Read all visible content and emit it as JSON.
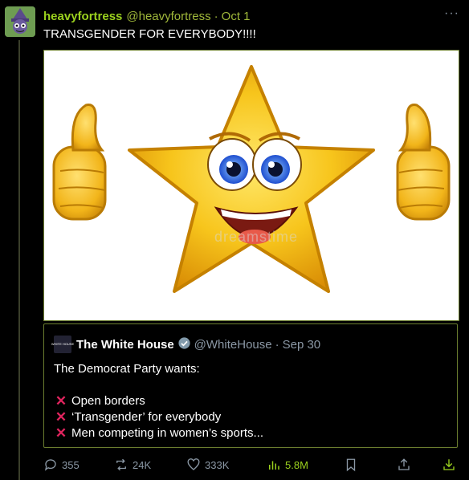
{
  "tweet": {
    "author_name": "heavyfortress",
    "author_handle": "@heavyfortress",
    "separator": "·",
    "date": "Oct 1",
    "more": "···",
    "text": "TRANSGENDER FOR EVERYBODY!!!!",
    "media_watermark": "dreamstime"
  },
  "quote": {
    "author_name": "The White House",
    "author_handle": "@WhiteHouse",
    "separator": "·",
    "date": "Sep 30",
    "avatar_text": "WHITE HOUSE",
    "intro": "The Democrat Party wants:",
    "items": [
      "Open borders",
      "‘Transgender’ for everybody",
      "Men competing in women’s sports..."
    ],
    "item_icon": "red-x-icon"
  },
  "actions": {
    "replies": "355",
    "reposts": "24K",
    "likes": "333K",
    "views": "5.8M"
  },
  "colors": {
    "accent": "#9bd11e",
    "x_mark": "#e0245e",
    "background": "#000000"
  }
}
